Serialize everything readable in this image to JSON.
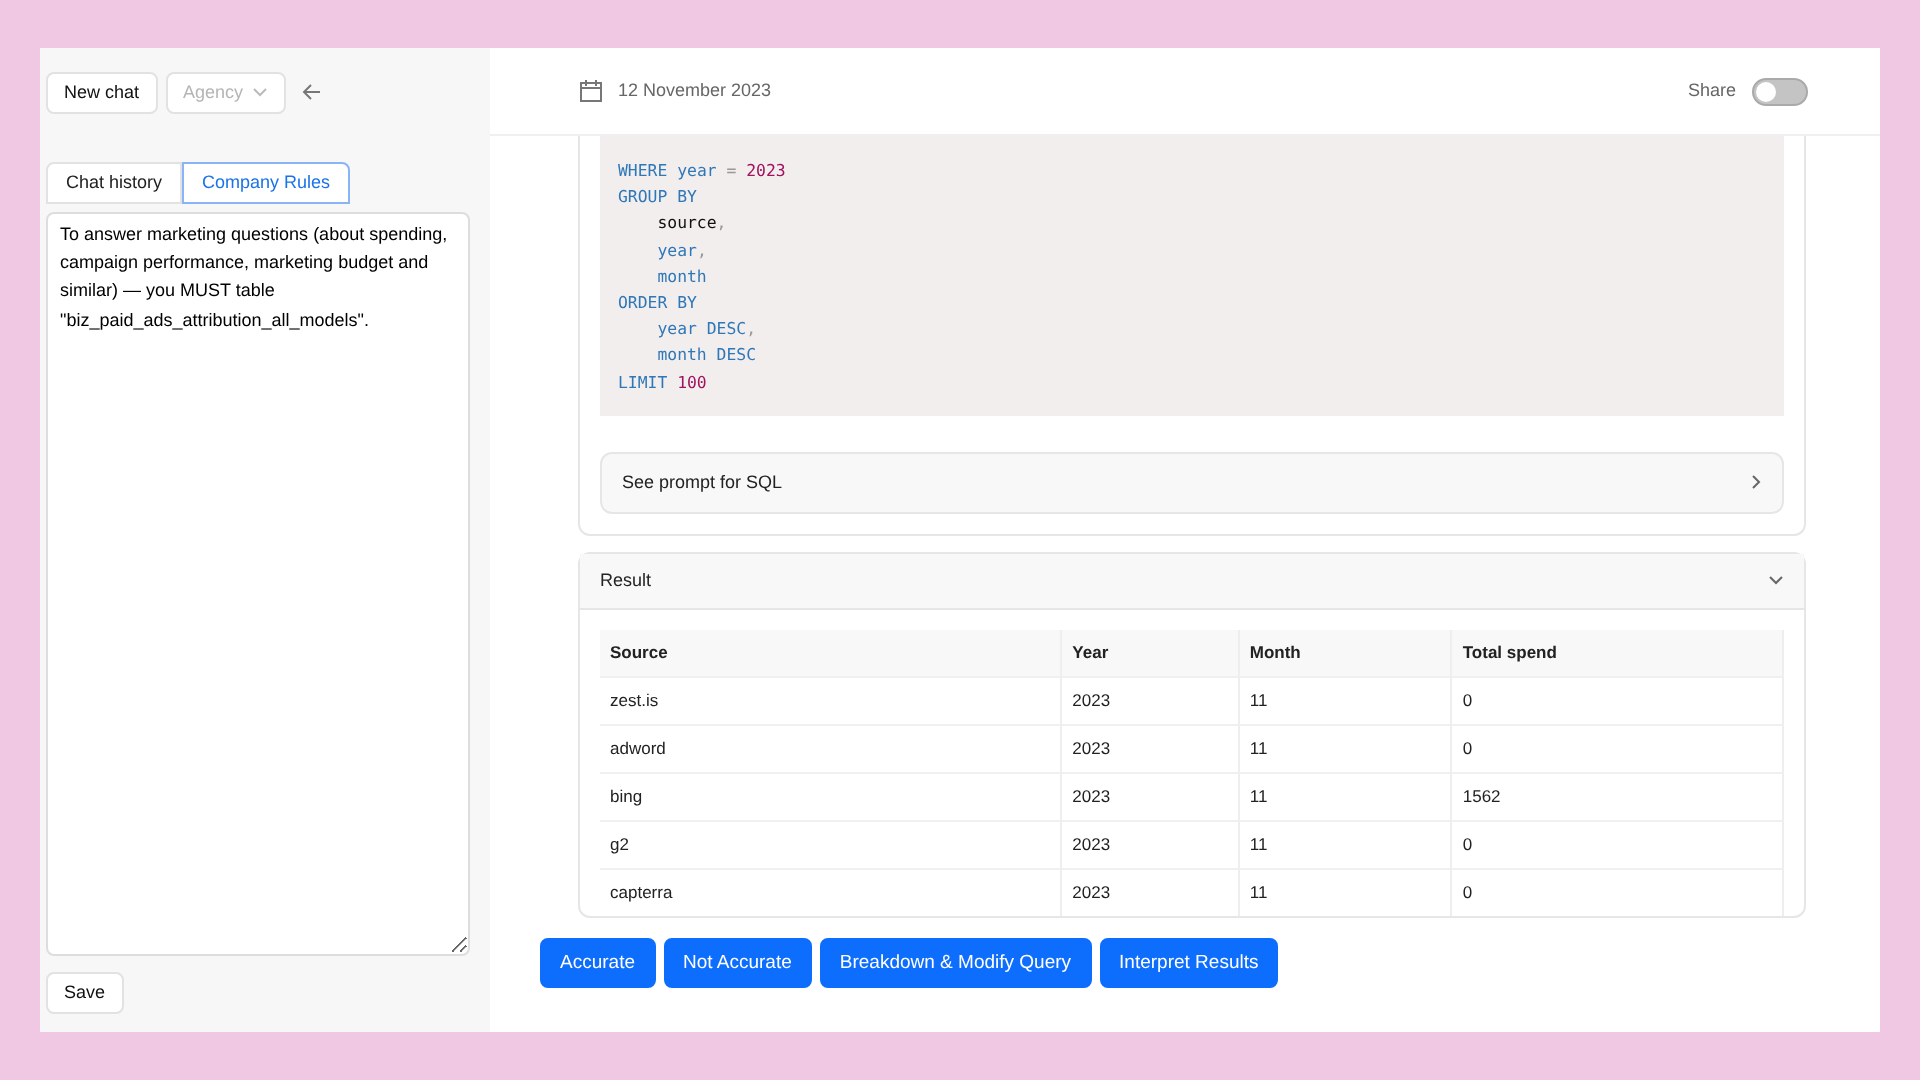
{
  "sidebar": {
    "new_chat": "New chat",
    "agency": {
      "label": "Agency",
      "disabled": true
    },
    "tabs": [
      {
        "label": "Chat history",
        "selected": false
      },
      {
        "label": "Company Rules",
        "selected": true
      }
    ],
    "rules_text": "To answer marketing questions (about spending, campaign performance, marketing budget and similar) — you MUST table \"biz_paid_ads_attribution_all_models\".",
    "save": "Save"
  },
  "header": {
    "date": "12 November 2023",
    "share": {
      "label": "Share",
      "on": false
    }
  },
  "code": [
    {
      "tokens": [
        {
          "text": "WHERE",
          "kind": "keyword"
        },
        {
          "text": " year ",
          "kind": "ident"
        },
        {
          "text": "=",
          "kind": "operator"
        },
        {
          "text": " 2023",
          "kind": "number"
        }
      ]
    },
    {
      "tokens": [
        {
          "text": "GROUP BY",
          "kind": "keyword"
        }
      ]
    },
    {
      "tokens": [
        {
          "text": "    source",
          "kind": "plain"
        },
        {
          "text": ",",
          "kind": "operator"
        }
      ]
    },
    {
      "tokens": [
        {
          "text": "    year",
          "kind": "ident"
        },
        {
          "text": ",",
          "kind": "operator"
        }
      ]
    },
    {
      "tokens": [
        {
          "text": "    month",
          "kind": "ident"
        }
      ]
    },
    {
      "tokens": [
        {
          "text": "ORDER BY",
          "kind": "keyword"
        }
      ]
    },
    {
      "tokens": [
        {
          "text": "    year DESC",
          "kind": "ident"
        },
        {
          "text": ",",
          "kind": "operator"
        }
      ]
    },
    {
      "tokens": [
        {
          "text": "    month DESC",
          "kind": "ident"
        }
      ]
    },
    {
      "tokens": [
        {
          "text": "LIMIT ",
          "kind": "keyword"
        },
        {
          "text": "100",
          "kind": "number"
        }
      ]
    }
  ],
  "prompt_toggle": {
    "label": "See prompt for SQL",
    "expanded": false
  },
  "result": {
    "title": "Result",
    "expanded": true,
    "columns": [
      "Source",
      "Year",
      "Month",
      "Total spend"
    ],
    "rows": [
      [
        "zest.is",
        "2023",
        "11",
        "0"
      ],
      [
        "adword",
        "2023",
        "11",
        "0"
      ],
      [
        "bing",
        "2023",
        "11",
        "1562"
      ],
      [
        "g2",
        "2023",
        "11",
        "0"
      ],
      [
        "capterra",
        "2023",
        "11",
        "0"
      ]
    ]
  },
  "actions": [
    "Accurate",
    "Not Accurate",
    "Breakdown & Modify Query",
    "Interpret Results"
  ]
}
